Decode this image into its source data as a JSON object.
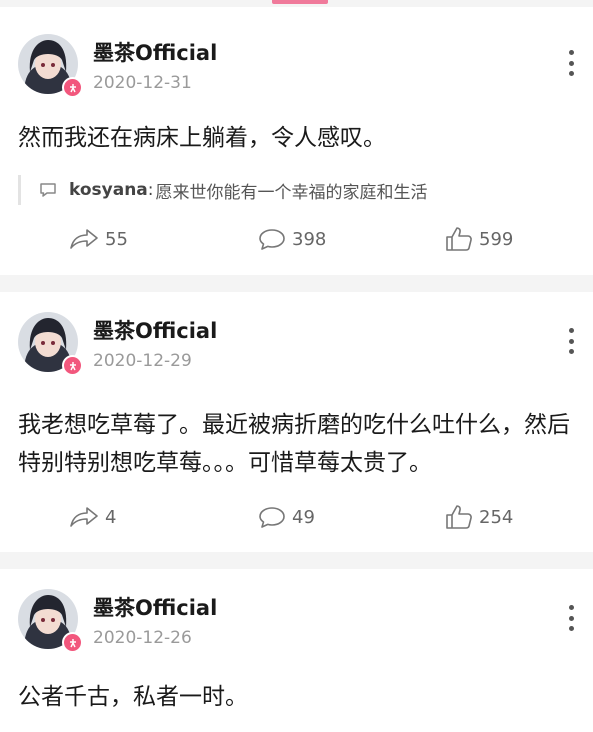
{
  "posts": [
    {
      "username": "墨茶Official",
      "date": "2020-12-31",
      "content": "然而我还在病床上躺着，令人感叹。",
      "comment": {
        "user": "kosyana",
        "separator": ":",
        "text": "愿来世你能有一个幸福的家庭和生活"
      },
      "shares": "55",
      "comments": "398",
      "likes": "599"
    },
    {
      "username": "墨茶Official",
      "date": "2020-12-29",
      "content": "我老想吃草莓了。最近被病折磨的吃什么吐什么，然后特别特别想吃草莓。。。可惜草莓太贵了。",
      "shares": "4",
      "comments": "49",
      "likes": "254"
    },
    {
      "username": "墨茶Official",
      "date": "2020-12-26",
      "content": "公者千古，私者一时。"
    }
  ],
  "icons": {
    "share": "share-arrow-icon",
    "comment": "speech-bubble-icon",
    "like": "thumbs-up-icon",
    "more": "vertical-dots-icon",
    "badge": "verified-badge-icon"
  },
  "colors": {
    "accent": "#f07a9b",
    "badge": "#f2577d"
  }
}
